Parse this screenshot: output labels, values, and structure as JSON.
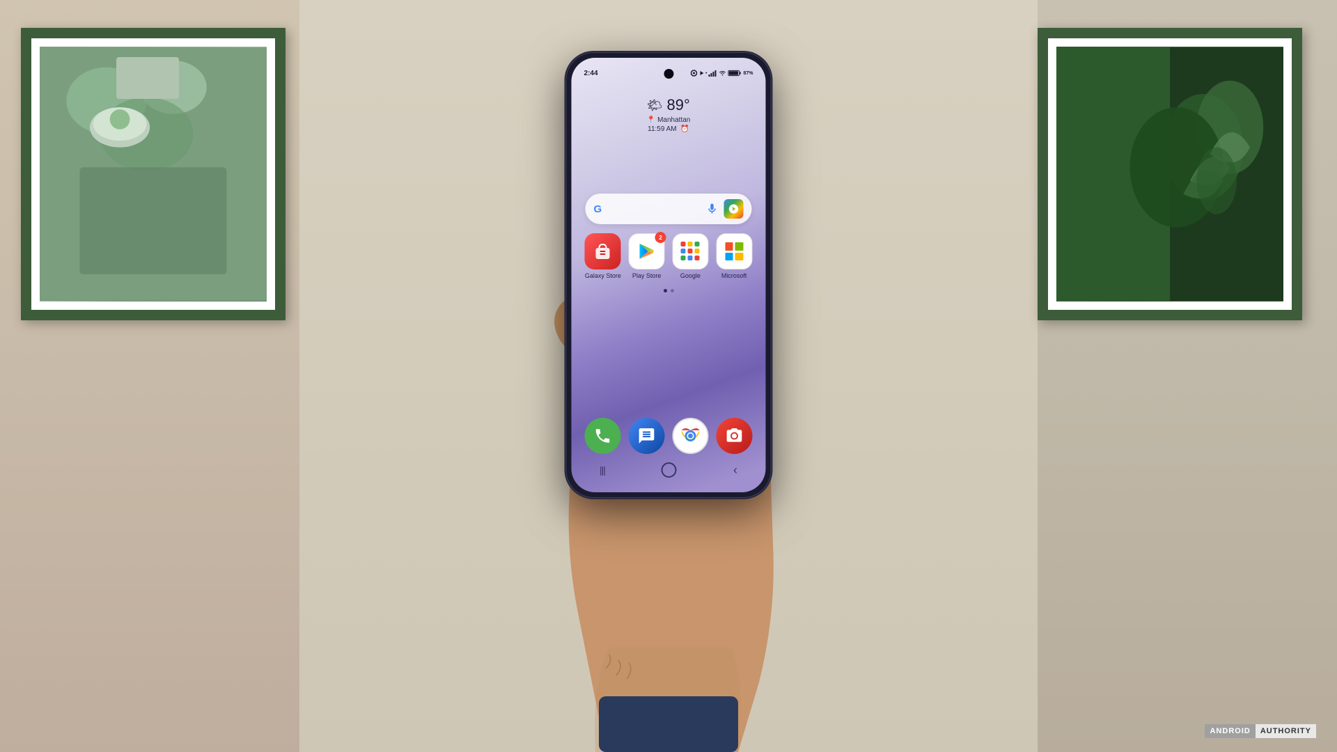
{
  "scene": {
    "bg_color": "#c8b89a"
  },
  "status_bar": {
    "time": "2:44",
    "battery": "87%",
    "icons": "⚙ ▶ •  📶 🔋"
  },
  "weather": {
    "icon": "🌤",
    "temp": "89°",
    "location": "Manhattan",
    "time": "11:59 AM"
  },
  "search": {
    "g_label": "G",
    "mic_icon": "🎤",
    "lens_icon": "🔍"
  },
  "apps": [
    {
      "name": "Galaxy Store",
      "bg": "#e83a3a",
      "label": "Galaxy Store"
    },
    {
      "name": "Play Store",
      "bg": "white",
      "label": "Play Store",
      "badge": "2"
    },
    {
      "name": "Google",
      "bg": "white",
      "label": "Google"
    },
    {
      "name": "Microsoft",
      "bg": "white",
      "label": "Microsoft"
    }
  ],
  "dock": [
    {
      "name": "Phone",
      "label": ""
    },
    {
      "name": "Messages",
      "label": ""
    },
    {
      "name": "Chrome",
      "label": ""
    },
    {
      "name": "Camera",
      "label": ""
    }
  ],
  "nav": {
    "recent": "|||",
    "home": "○",
    "back": "‹"
  },
  "watermark": {
    "android": "ANDROID",
    "authority": "AUTHORITY"
  }
}
